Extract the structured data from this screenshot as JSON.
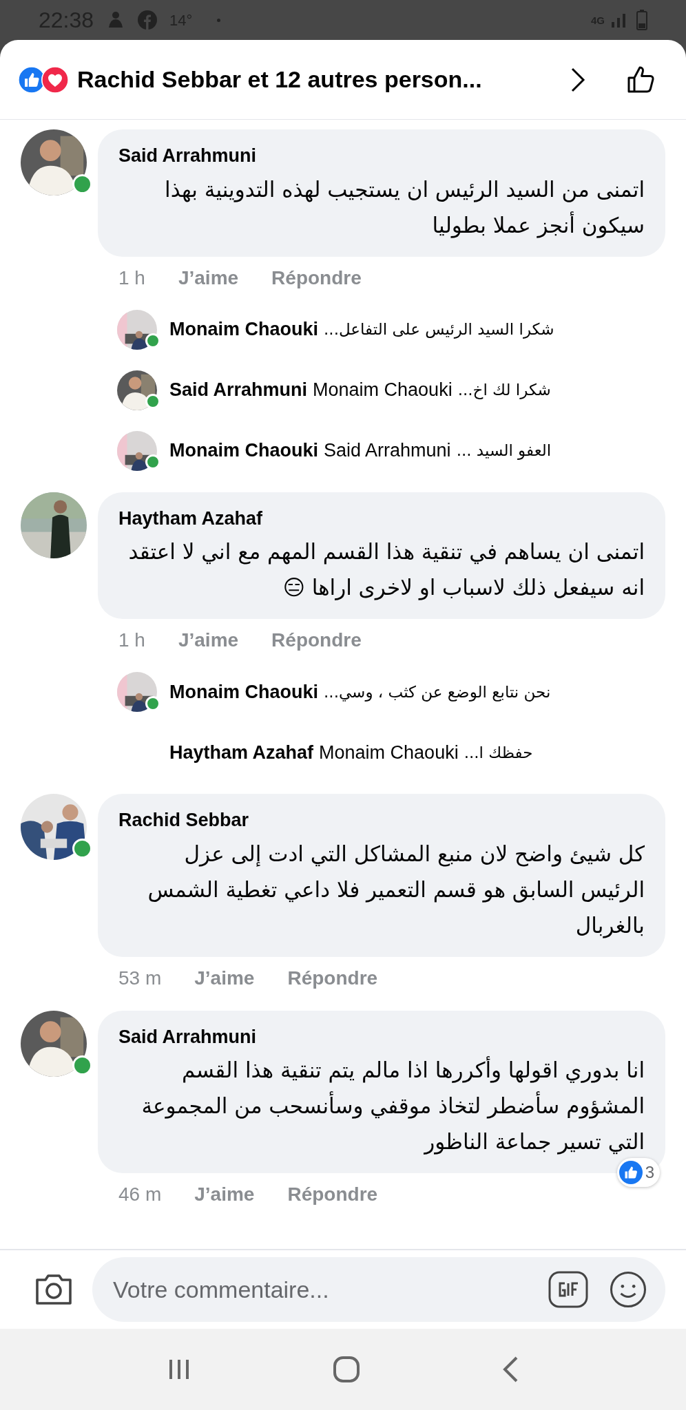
{
  "status_bar": {
    "time": "22:38",
    "temperature": "14°",
    "network": "4G"
  },
  "header": {
    "title": "Rachid Sebbar et 12 autres person..."
  },
  "comments": [
    {
      "author": "Said Arrahmuni",
      "online": true,
      "text": "اتمنى من السيد الرئيس ان يستجيب لهذه التدوينية بهذا سيكون أنجز  عملا بطوليا",
      "time": "1 h",
      "like": "J’aime",
      "reply": "Répondre",
      "replies": [
        {
          "author": "Monaim Chaouki",
          "show_avatar": true,
          "online": true,
          "text": "شكرا السيد الرئيس على التفاعل..."
        },
        {
          "author": "Said Arrahmuni",
          "show_avatar": true,
          "online": true,
          "mention": "Monaim Chaouki",
          "text": "شكرا لك اخ..."
        },
        {
          "author": "Monaim Chaouki",
          "show_avatar": true,
          "online": true,
          "mention": "Said Arrahmuni",
          "text": "العفو السيد ..."
        }
      ]
    },
    {
      "author": "Haytham Azahaf",
      "online": false,
      "text": "اتمنى ان يساهم في تنقية هذا القسم المهم مع اني لا اعتقد انه سيفعل ذلك لاسباب او لاخرى اراها 😑",
      "time": "1 h",
      "like": "J’aime",
      "reply": "Répondre",
      "replies": [
        {
          "author": "Monaim Chaouki",
          "show_avatar": true,
          "online": true,
          "text": "نحن نتابع الوضع عن كثب ، وسي..."
        },
        {
          "author": "Haytham Azahaf",
          "show_avatar": false,
          "mention": "Monaim Chaouki",
          "text": "حفظك ا..."
        }
      ]
    },
    {
      "author": "Rachid Sebbar",
      "online": true,
      "text": "كل شيئ واضح لان منبع المشاكل التي ادت إلى عزل الرئيس السابق هو قسم التعمير فلا داعي تغطية الشمس بالغربال",
      "time": "53 m",
      "like": "J’aime",
      "reply": "Répondre"
    },
    {
      "author": "Said Arrahmuni",
      "online": true,
      "text": "انا بدوري اقولها وأكررها اذا مالم يتم تنقية هذا القسم المشؤوم سأضطر لتخاذ موقفي وسأنسحب من المجموعة التي تسير جماعة الناظور",
      "time": "46 m",
      "like": "J’aime",
      "reply": "Répondre",
      "reactions": "3"
    }
  ],
  "composer": {
    "placeholder": "Votre commentaire..."
  }
}
